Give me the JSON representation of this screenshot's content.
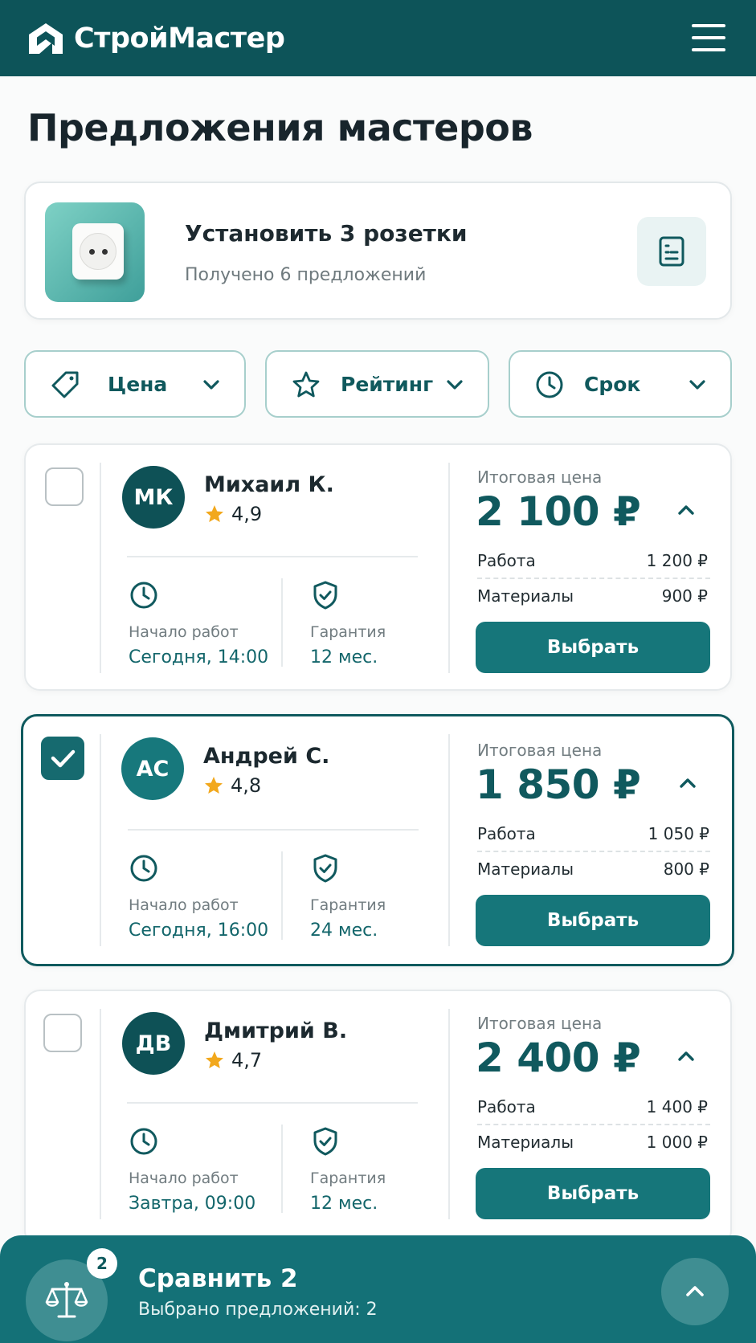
{
  "header": {
    "brand": "СтройМастер"
  },
  "page_title": "Предложения мастеров",
  "task": {
    "title": "Установить 3 розетки",
    "subtitle": "Получено 6 предложений"
  },
  "filters": [
    {
      "label": "Цена",
      "icon": "tag-icon"
    },
    {
      "label": "Рейтинг",
      "icon": "star-outline-icon"
    },
    {
      "label": "Срок",
      "icon": "clock-icon"
    }
  ],
  "offers": [
    {
      "initials": "МК",
      "avatar_color": "#0e5156",
      "name": "Михаил К.",
      "rating": "4,9",
      "start_label": "Начало работ",
      "start_value": "Сегодня, 14:00",
      "warranty_label": "Гарантия",
      "warranty_value": "12 мес.",
      "price_label": "Итоговая цена",
      "price": "2 100 ₽",
      "work_label": "Работа",
      "work_value": "1 200 ₽",
      "materials_label": "Материалы",
      "materials_value": "900 ₽",
      "select_label": "Выбрать",
      "selected": false
    },
    {
      "initials": "АС",
      "avatar_color": "#17787c",
      "name": "Андрей С.",
      "rating": "4,8",
      "start_label": "Начало работ",
      "start_value": "Сегодня, 16:00",
      "warranty_label": "Гарантия",
      "warranty_value": "24 мес.",
      "price_label": "Итоговая цена",
      "price": "1 850 ₽",
      "work_label": "Работа",
      "work_value": "1 050 ₽",
      "materials_label": "Материалы",
      "materials_value": "800 ₽",
      "select_label": "Выбрать",
      "selected": true
    },
    {
      "initials": "ДВ",
      "avatar_color": "#0e5156",
      "name": "Дмитрий В.",
      "rating": "4,7",
      "start_label": "Начало работ",
      "start_value": "Завтра, 09:00",
      "warranty_label": "Гарантия",
      "warranty_value": "12 мес.",
      "price_label": "Итоговая цена",
      "price": "2 400 ₽",
      "work_label": "Работа",
      "work_value": "1 400 ₽",
      "materials_label": "Материалы",
      "materials_value": "1 000 ₽",
      "select_label": "Выбрать",
      "selected": false
    }
  ],
  "compare": {
    "badge": "2",
    "title": "Сравнить 2",
    "subtitle": "Выбрано предложений: 2"
  },
  "colors": {
    "primary": "#0d5459",
    "accent": "#16767a",
    "star": "#f2a81d"
  }
}
